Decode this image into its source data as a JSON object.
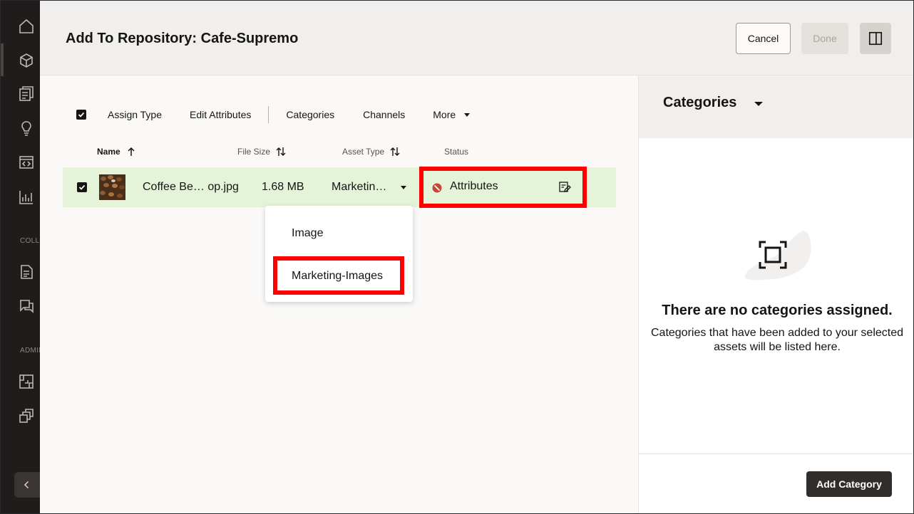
{
  "nav": {
    "section_collections": "COLLECTIONS",
    "section_admin": "ADMINISTRATION",
    "icons": [
      "home-icon",
      "cube-icon",
      "pages-icon",
      "lightbulb-icon",
      "code-window-icon",
      "chart-icon",
      "document-icon",
      "chat-icon",
      "integrations-icon",
      "layers-icon"
    ]
  },
  "header": {
    "title": "Add To Repository: Cafe-Supremo",
    "cancel_label": "Cancel",
    "done_label": "Done"
  },
  "toolbar": {
    "items": [
      "Assign Type",
      "Edit Attributes",
      "Categories",
      "Channels",
      "More"
    ]
  },
  "table": {
    "columns": {
      "name": "Name",
      "file_size": "File Size",
      "asset_type": "Asset Type",
      "status": "Status"
    },
    "row": {
      "name": "Coffee Be… op.jpg",
      "file_size": "1.68 MB",
      "asset_type": "Marketin…",
      "status": "Attributes"
    }
  },
  "asset_type_menu": {
    "options": [
      "Image",
      "Marketing-Images"
    ]
  },
  "side_panel": {
    "title": "Categories",
    "empty_title": "There are no categories assigned.",
    "empty_desc": "Categories that have been added to your selected assets will be listed here.",
    "add_button": "Add Category"
  },
  "colors": {
    "nav_bg": "#201c1c",
    "header_bg": "#f0efed",
    "row_selected": "#e5f4d9",
    "highlight": "#ff0000",
    "primary_button": "#312d2a",
    "error_status": "#c74634"
  }
}
